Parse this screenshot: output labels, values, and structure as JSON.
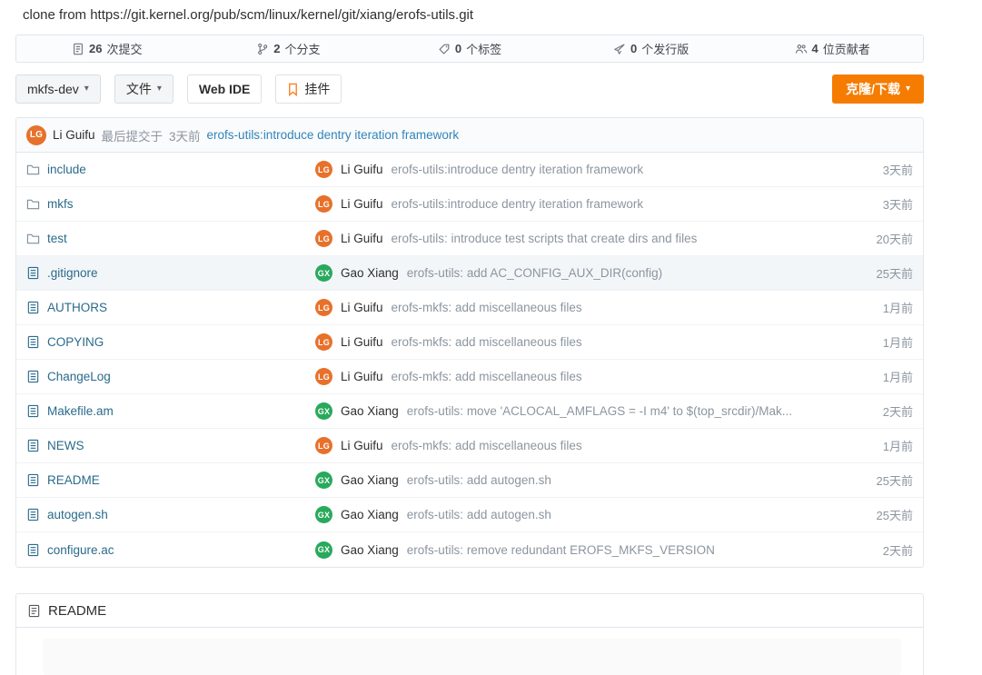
{
  "header": {
    "clone_line": "clone from https://git.kernel.org/pub/scm/linux/kernel/git/xiang/erofs-utils.git"
  },
  "stats": [
    {
      "icon": "commits-icon",
      "count": "26",
      "label": "次提交"
    },
    {
      "icon": "branch-icon",
      "count": "2",
      "label": "个分支"
    },
    {
      "icon": "tag-icon",
      "count": "0",
      "label": "个标签"
    },
    {
      "icon": "release-icon",
      "count": "0",
      "label": "个发行版"
    },
    {
      "icon": "contributors-icon",
      "count": "4",
      "label": "位贡献者"
    }
  ],
  "toolbar": {
    "branch_selector": "mkfs-dev",
    "files_dropdown": "文件",
    "web_ide": "Web IDE",
    "widget": "挂件",
    "clone_download": "克隆/下载"
  },
  "last_commit": {
    "avatar": "LG",
    "author": "Li Guifu",
    "prefix": "最后提交于",
    "time": "3天前",
    "message": "erofs-utils:introduce dentry iteration framework"
  },
  "files": [
    {
      "type": "folder",
      "name": "include",
      "avatar": "LG",
      "author": "Li Guifu",
      "message": "erofs-utils:introduce dentry iteration framework",
      "time": "3天前",
      "highlighted": false
    },
    {
      "type": "folder",
      "name": "mkfs",
      "avatar": "LG",
      "author": "Li Guifu",
      "message": "erofs-utils:introduce dentry iteration framework",
      "time": "3天前",
      "highlighted": false
    },
    {
      "type": "folder",
      "name": "test",
      "avatar": "LG",
      "author": "Li Guifu",
      "message": "erofs-utils: introduce test scripts that create dirs and files",
      "time": "20天前",
      "highlighted": false
    },
    {
      "type": "file",
      "name": ".gitignore",
      "avatar": "GX",
      "author": "Gao Xiang",
      "message": "erofs-utils: add AC_CONFIG_AUX_DIR(config)",
      "time": "25天前",
      "highlighted": true
    },
    {
      "type": "file",
      "name": "AUTHORS",
      "avatar": "LG",
      "author": "Li Guifu",
      "message": "erofs-mkfs: add miscellaneous files",
      "time": "1月前",
      "highlighted": false
    },
    {
      "type": "file",
      "name": "COPYING",
      "avatar": "LG",
      "author": "Li Guifu",
      "message": "erofs-mkfs: add miscellaneous files",
      "time": "1月前",
      "highlighted": false
    },
    {
      "type": "file",
      "name": "ChangeLog",
      "avatar": "LG",
      "author": "Li Guifu",
      "message": "erofs-mkfs: add miscellaneous files",
      "time": "1月前",
      "highlighted": false
    },
    {
      "type": "file",
      "name": "Makefile.am",
      "avatar": "GX",
      "author": "Gao Xiang",
      "message": "erofs-utils: move 'ACLOCAL_AMFLAGS = -I m4' to $(top_srcdir)/Mak...",
      "time": "2天前",
      "highlighted": false
    },
    {
      "type": "file",
      "name": "NEWS",
      "avatar": "LG",
      "author": "Li Guifu",
      "message": "erofs-mkfs: add miscellaneous files",
      "time": "1月前",
      "highlighted": false
    },
    {
      "type": "file",
      "name": "README",
      "avatar": "GX",
      "author": "Gao Xiang",
      "message": "erofs-utils: add autogen.sh",
      "time": "25天前",
      "highlighted": false
    },
    {
      "type": "file",
      "name": "autogen.sh",
      "avatar": "GX",
      "author": "Gao Xiang",
      "message": "erofs-utils: add autogen.sh",
      "time": "25天前",
      "highlighted": false
    },
    {
      "type": "file",
      "name": "configure.ac",
      "avatar": "GX",
      "author": "Gao Xiang",
      "message": "erofs-utils: remove redundant EROFS_MKFS_VERSION",
      "time": "2天前",
      "highlighted": false
    }
  ],
  "readme": {
    "title": "README"
  },
  "avatar_colors": {
    "LG": "#e7712b",
    "GX": "#29a95c"
  },
  "colors": {
    "accent_orange": "#f57c00",
    "commit_link_blue": "#3084bb",
    "file_link_teal": "#2a6a8a",
    "muted_gray": "#8c959f"
  }
}
